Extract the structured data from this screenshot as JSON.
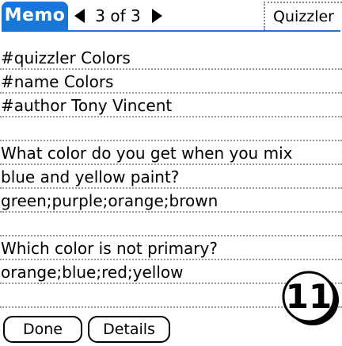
{
  "title_bar": {
    "app_tab": "Memo",
    "page_indicator": "3 of 3",
    "category": "Quizzler"
  },
  "memo": {
    "lines": [
      "#quizzler Colors",
      "#name Colors",
      "#author Tony Vincent",
      "",
      "What color do you get when you mix",
      "blue and yellow paint?",
      "green;purple;orange;brown",
      "",
      "Which color is not primary?",
      "orange;blue;red;yellow",
      "",
      ""
    ]
  },
  "buttons": {
    "done": "Done",
    "details": "Details"
  },
  "badge": {
    "number": "11"
  },
  "colors": {
    "title_accent": "#1776d6",
    "rule_dots": "#9a9a9a"
  }
}
